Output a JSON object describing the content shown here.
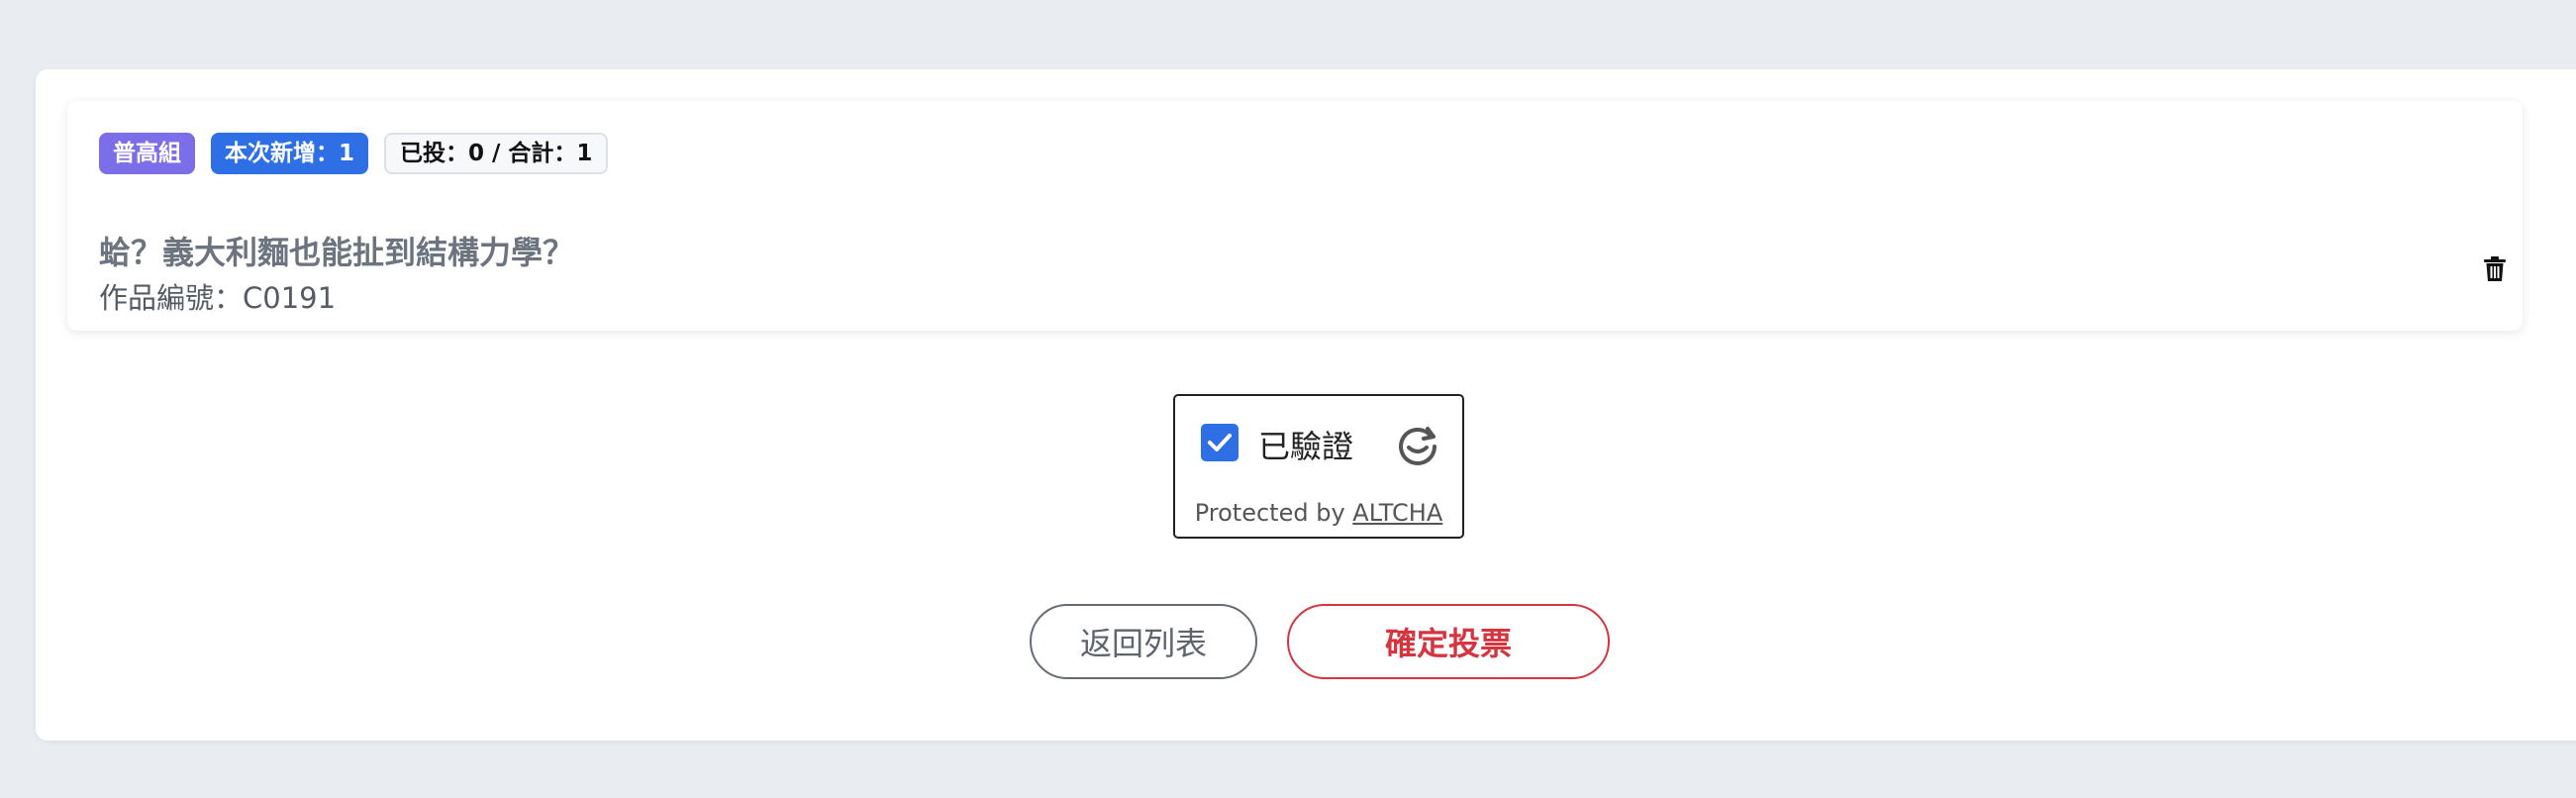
{
  "colors": {
    "group_badge": "#7b6ee8",
    "new_badge": "#2f6fe6",
    "confirm": "#d6343f",
    "checkbox": "#2f6fe6"
  },
  "item": {
    "badges": {
      "group": "普高組",
      "added": "本次新增：1",
      "count": "已投：0 / 合計：1"
    },
    "title": "蛤？義大利麵也能扯到結構力學？",
    "code": "作品編號：C0191",
    "delete_icon": "trash-icon"
  },
  "captcha": {
    "checked": true,
    "label": "已驗證",
    "protected_by": "Protected by ",
    "brand": "ALTCHA",
    "logo_icon": "altcha-logo-icon"
  },
  "actions": {
    "back_label": "返回列表",
    "confirm_label": "確定投票"
  }
}
